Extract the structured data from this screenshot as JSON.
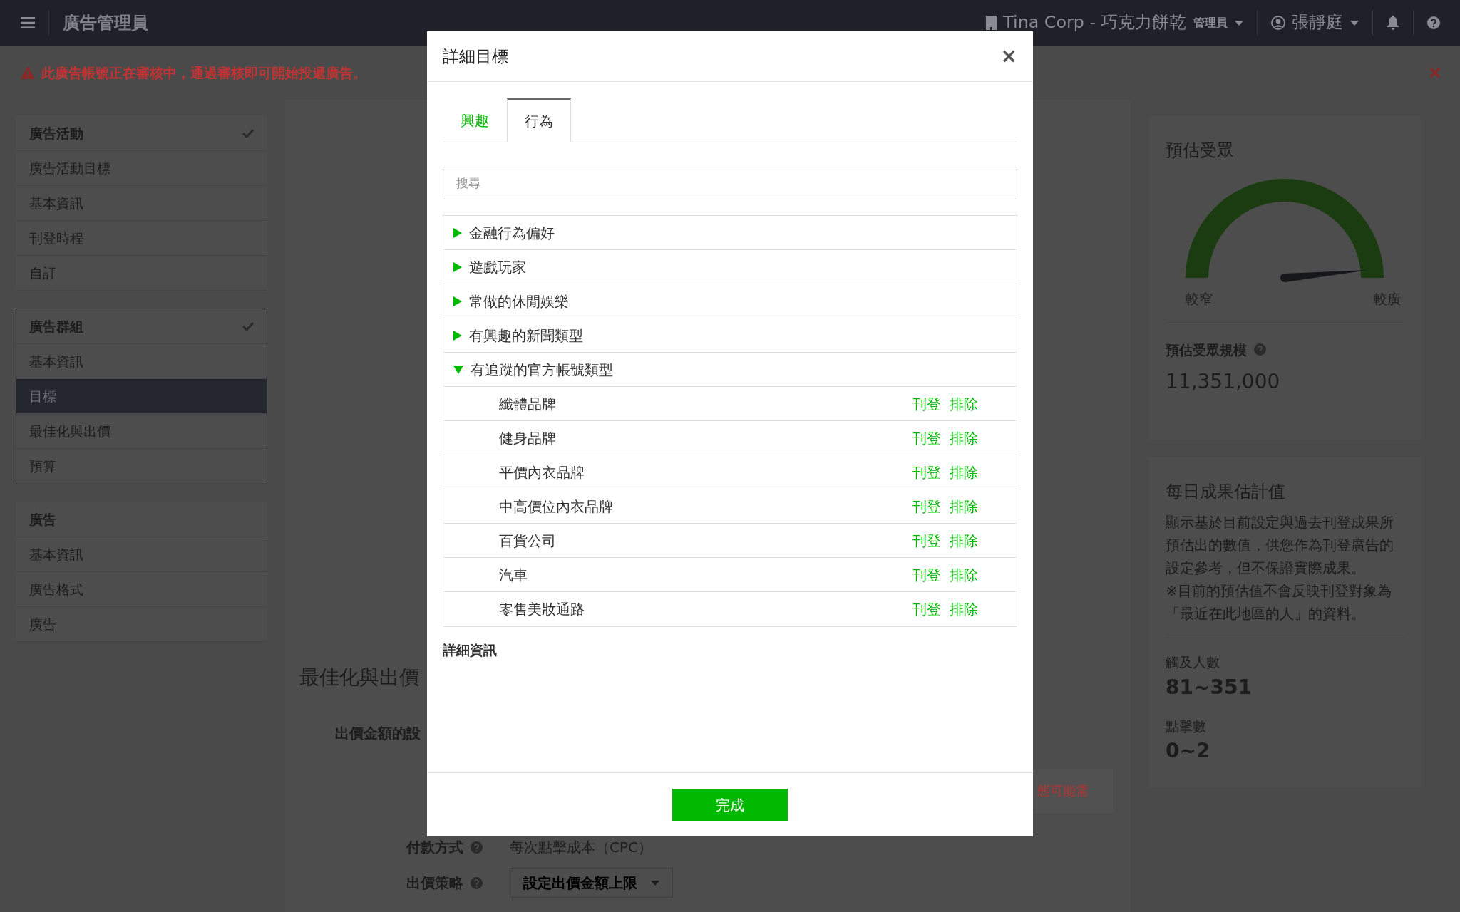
{
  "topbar": {
    "title": "廣告管理員",
    "account": "Tina Corp - 巧克力餅乾",
    "role": "管理員",
    "user": "張靜庭"
  },
  "alert": {
    "message": "此廣告帳號正在審核中，通過審核即可開始投遞廣告。"
  },
  "sidebar": {
    "groups": [
      {
        "title": "廣告活動",
        "completed": true,
        "current": false,
        "items": [
          {
            "label": "廣告活動目標",
            "selected": false
          },
          {
            "label": "基本資訊",
            "selected": false
          },
          {
            "label": "刊登時程",
            "selected": false
          },
          {
            "label": "自訂",
            "selected": false
          }
        ]
      },
      {
        "title": "廣告群組",
        "completed": true,
        "current": true,
        "items": [
          {
            "label": "基本資訊",
            "selected": false
          },
          {
            "label": "目標",
            "selected": true
          },
          {
            "label": "最佳化與出價",
            "selected": false
          },
          {
            "label": "預算",
            "selected": false
          }
        ]
      },
      {
        "title": "廣告",
        "completed": false,
        "current": false,
        "items": [
          {
            "label": "基本資訊",
            "selected": false
          },
          {
            "label": "廣告格式",
            "selected": false
          },
          {
            "label": "廣告",
            "selected": false
          }
        ]
      }
    ]
  },
  "background_form": {
    "section_title": "最佳化與出價",
    "bid_label": "出價金額的設",
    "notice": "態可能需",
    "payment_label": "付款方式",
    "payment_value": "每次點擊成本（CPC）",
    "strategy_label": "出價策略",
    "strategy_value": "設定出價金額上限"
  },
  "audience": {
    "title": "預估受眾",
    "gauge": {
      "min_label": "較窄",
      "max_label": "較廣"
    },
    "size_label": "預估受眾規模",
    "size_value": "11,351,000"
  },
  "daily": {
    "title": "每日成果估計值",
    "paragraphs": [
      "顯示基於目前設定與過去刊登成果所預估出的數值，供您作為刊登廣告的設定參考，但不保證實際成果。",
      "※目前的預估值不會反映刊登對象為「最近在此地區的人」的資料。"
    ],
    "metrics": [
      {
        "label": "觸及人數",
        "value": "81~351"
      },
      {
        "label": "點擊數",
        "value": "0~2"
      }
    ]
  },
  "modal": {
    "title": "詳細目標",
    "close": "×",
    "tabs": [
      {
        "label": "興趣",
        "selected": false
      },
      {
        "label": "行為",
        "selected": true
      }
    ],
    "search": {
      "placeholder": "搜尋"
    },
    "categories": [
      {
        "label": "金融行為偏好",
        "expanded": false
      },
      {
        "label": "遊戲玩家",
        "expanded": false
      },
      {
        "label": "常做的休閒娛樂",
        "expanded": false
      },
      {
        "label": "有興趣的新聞類型",
        "expanded": false
      },
      {
        "label": "有追蹤的官方帳號類型",
        "expanded": true,
        "children": [
          {
            "label": "纖體品牌",
            "actions": [
              "刊登",
              "排除"
            ]
          },
          {
            "label": "健身品牌",
            "actions": [
              "刊登",
              "排除"
            ]
          },
          {
            "label": "平價內衣品牌",
            "actions": [
              "刊登",
              "排除"
            ]
          },
          {
            "label": "中高價位內衣品牌",
            "actions": [
              "刊登",
              "排除"
            ]
          },
          {
            "label": "百貨公司",
            "actions": [
              "刊登",
              "排除"
            ]
          },
          {
            "label": "汽車",
            "actions": [
              "刊登",
              "排除"
            ]
          },
          {
            "label": "零售美妝通路",
            "actions": [
              "刊登",
              "排除"
            ]
          }
        ]
      }
    ],
    "detail_title": "詳細資訊",
    "done_button": "完成"
  }
}
